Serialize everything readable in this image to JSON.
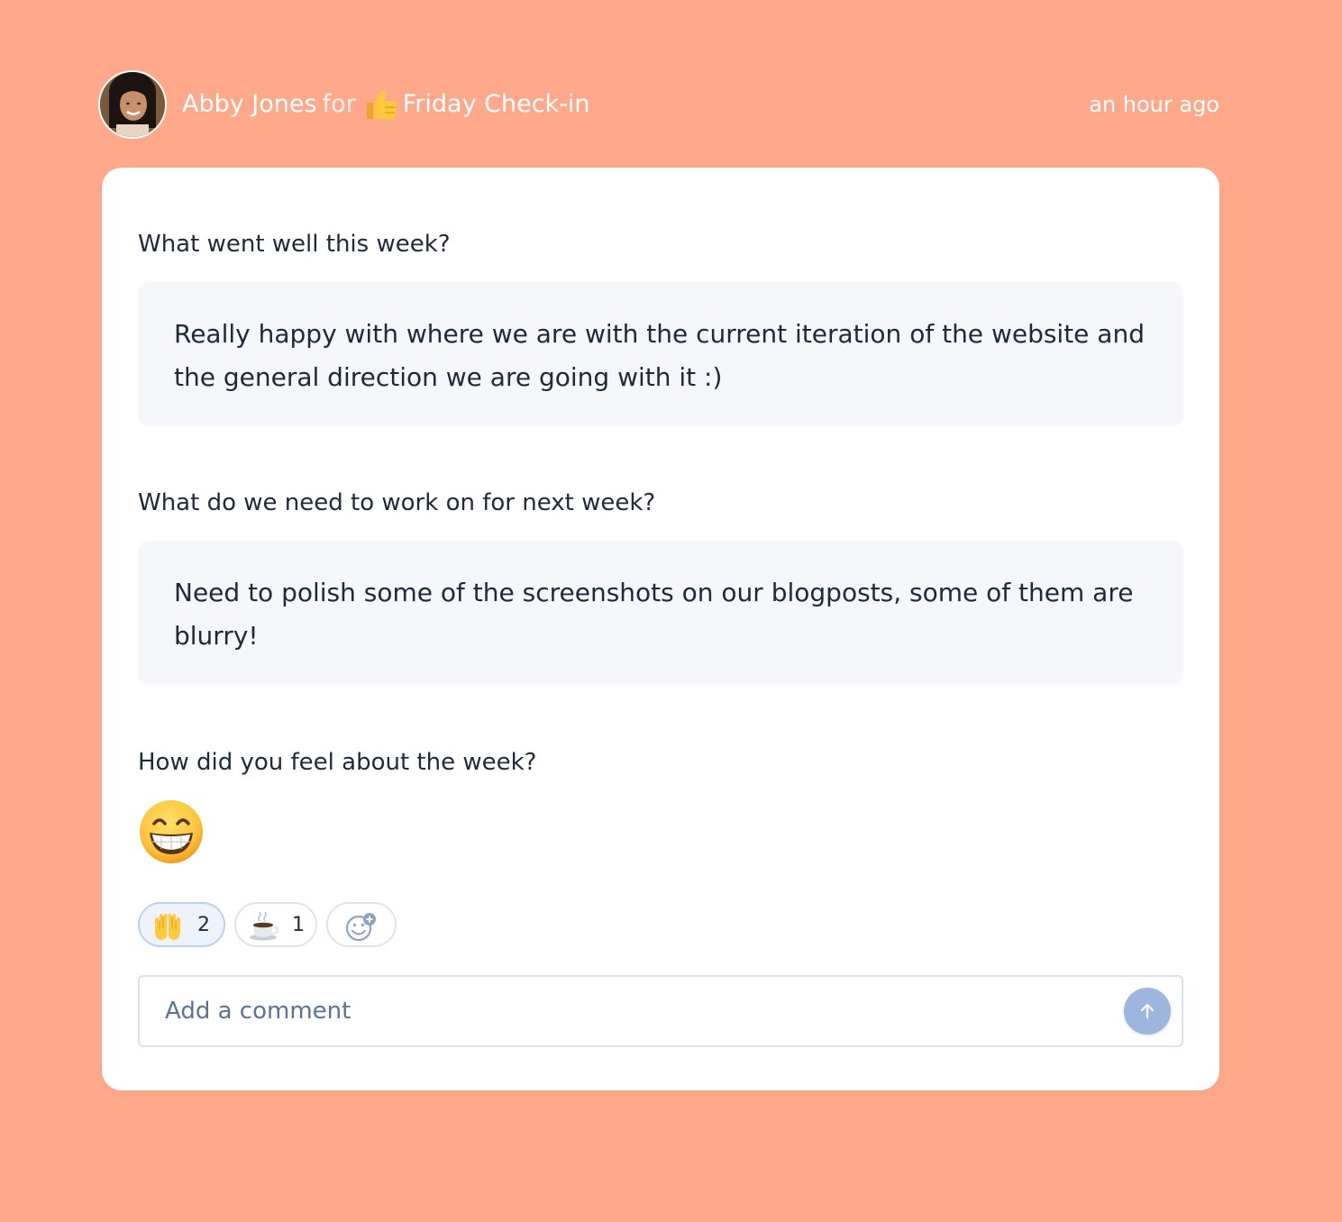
{
  "header": {
    "author": "Abby Jones",
    "for_label": "for",
    "checkin_name": "Friday Check-in",
    "checkin_icon": "thumbs-up-icon",
    "timestamp": "an hour ago"
  },
  "questions": [
    {
      "question": "What went well this week?",
      "answer": "Really happy with where we are with the current iteration of the website and the general direction we are going with it :)"
    },
    {
      "question": "What do we need to work on for next week?",
      "answer": "Need to polish some of the screenshots on our blogposts, some of them are blurry!"
    },
    {
      "question": "How did you feel about the week?",
      "answer_icon": "grinning-face-icon"
    }
  ],
  "reactions": [
    {
      "icon": "raising-hands-icon",
      "count": "2",
      "active": true
    },
    {
      "icon": "hot-beverage-icon",
      "count": "1",
      "active": false
    },
    {
      "icon": "add-reaction-icon"
    }
  ],
  "comment": {
    "placeholder": "Add a comment",
    "value": "",
    "send_icon": "arrow-up-icon"
  },
  "colors": {
    "background": "#FFA98A",
    "card": "#FFFFFF",
    "answer_bg": "#F5F7FA",
    "send_button": "#9EB6DD",
    "text": "#1E2A3A"
  }
}
